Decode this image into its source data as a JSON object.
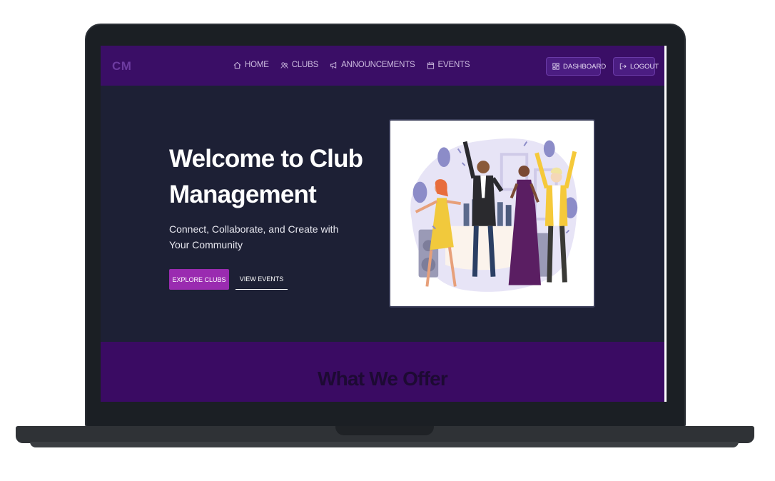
{
  "brand": "CM",
  "nav": {
    "links": [
      {
        "label": "HOME",
        "icon": "home-icon"
      },
      {
        "label": "CLUBS",
        "icon": "people-icon"
      },
      {
        "label": "ANNOUNCEMENTS",
        "icon": "megaphone-icon"
      },
      {
        "label": "EVENTS",
        "icon": "calendar-icon"
      }
    ],
    "dashboard_label": "DASHBOARD",
    "logout_label": "LOGOUT"
  },
  "hero": {
    "title": "Welcome to Club Management",
    "subtitle": "Connect, Collaborate, and Create with Your Community",
    "explore_label": "EXPLORE CLUBS",
    "events_label": "VIEW EVENTS",
    "illustration": "party-illustration"
  },
  "offer": {
    "title": "What We Offer"
  },
  "colors": {
    "navbar": "#3a0e66",
    "hero_bg": "#1d2035",
    "accent": "#9a2bb0",
    "offer_bg": "#3a0b63"
  }
}
